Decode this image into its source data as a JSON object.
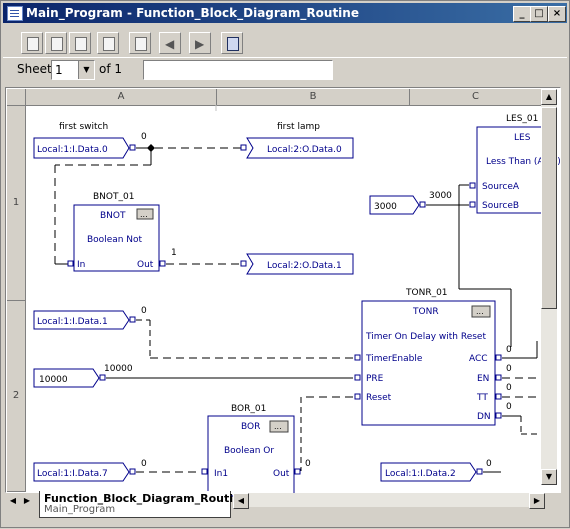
{
  "window": {
    "title": "Main_Program - Function_Block_Diagram_Routine",
    "controls": {
      "minimize": "_",
      "restore": "□",
      "close": "×"
    }
  },
  "toolbar": {
    "buttons": [
      "properties-icon",
      "edit-icon",
      "verify-icon",
      "new-sheet-icon",
      "delete-sheet-icon",
      "prev-sheet-icon",
      "next-sheet-icon",
      "zoom-icon"
    ]
  },
  "sheet": {
    "label": "Sheet",
    "value": "1",
    "of_label": "of 1",
    "description": ""
  },
  "grid": {
    "columns": [
      "A",
      "B",
      "C"
    ],
    "rows": [
      "1",
      "2"
    ]
  },
  "diagram": {
    "labels": {
      "first_switch": "first switch",
      "first_lamp": "first lamp",
      "bnot_name": "BNOT_01",
      "bor_name": "BOR_01",
      "tonr_name": "TONR_01",
      "les_name": "LES_01"
    },
    "tags": {
      "in_data0": "Local:1:I.Data.0",
      "out_data0": "Local:2:O.Data.0",
      "out_data1": "Local:2:O.Data.1",
      "in_data1": "Local:1:I.Data.1",
      "in_data7": "Local:1:I.Data.7",
      "in_data2": "Local:1:I.Data.2",
      "const_3000": "3000",
      "const_10000": "10000"
    },
    "values": {
      "sw0": "0",
      "bnot_out": "1",
      "in1": "0",
      "pre": "10000",
      "src_b": "3000",
      "acc": "0",
      "en": "0",
      "tt": "0",
      "dn": "0",
      "in7": "0",
      "bor_out": "0",
      "in2": "0"
    },
    "blocks": {
      "bnot": {
        "type": "BNOT",
        "desc": "Boolean Not",
        "in": "In",
        "out": "Out",
        "btn": "..."
      },
      "tonr": {
        "type": "TONR",
        "desc": "Timer On Delay with Reset",
        "p1": "TimerEnable",
        "p2": "PRE",
        "p3": "Reset",
        "o1": "ACC",
        "o2": "EN",
        "o3": "TT",
        "o4": "DN",
        "btn": "..."
      },
      "les": {
        "type": "LES",
        "desc": "Less Than (A<B)",
        "p1": "SourceA",
        "p2": "SourceB"
      },
      "bor": {
        "type": "BOR",
        "desc": "Boolean Or",
        "in1": "In1",
        "out": "Out",
        "btn": "..."
      }
    }
  },
  "tab": {
    "title": "Function_Block_Diagram_Routine",
    "subtitle": "Main_Program"
  },
  "colors": {
    "accent": "#0a246a",
    "wire": "#000000",
    "block": "#00008b"
  }
}
